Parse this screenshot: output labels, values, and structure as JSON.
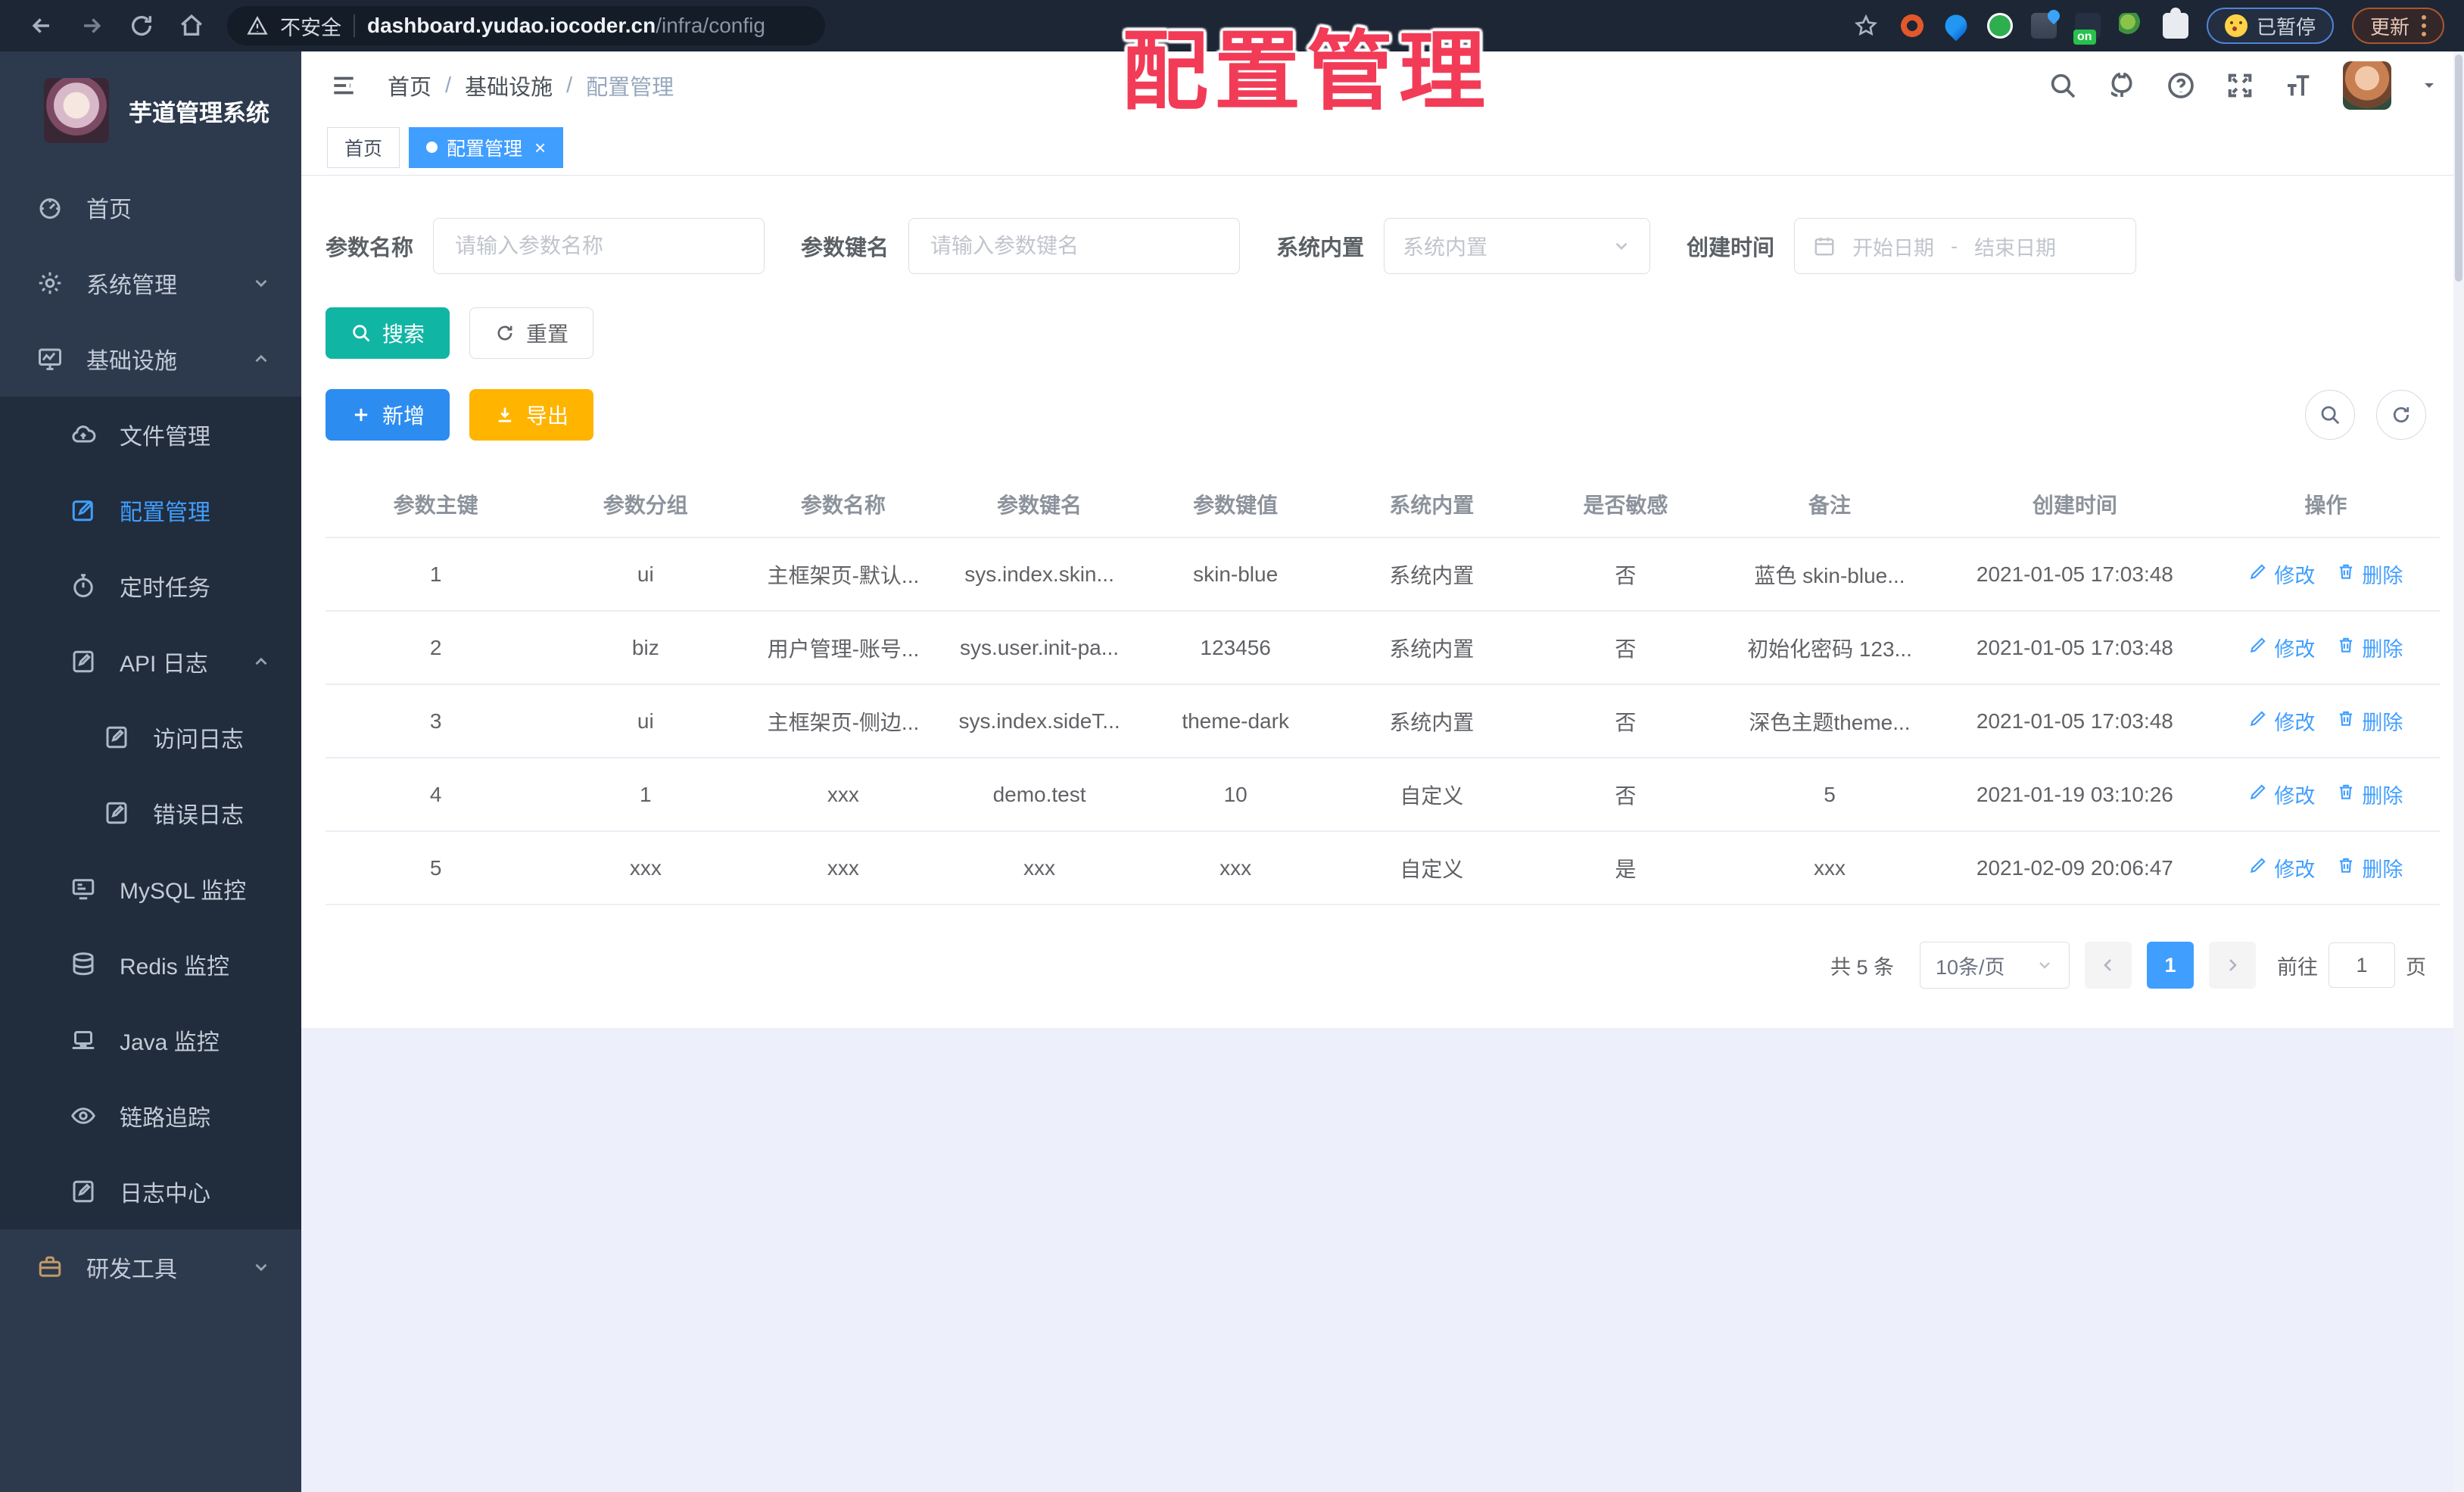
{
  "colors": {
    "accent": "#409eff",
    "search_btn": "#11b5a4",
    "add_btn": "#2d8cf0",
    "export_btn": "#ffb400",
    "overlay_red": "#f23b57",
    "sidebar_bg": "#2d3a4e",
    "submenu_bg": "#212c3c",
    "browser_bg": "#1d2634"
  },
  "overlay_title": "配置管理",
  "browser": {
    "security_label": "不安全",
    "url_host": "dashboard.yudao.iocoder.cn",
    "url_path": "/infra/config",
    "ext_badge": "on",
    "paused_label": "已暂停",
    "update_label": "更新"
  },
  "sidebar": {
    "title": "芋道管理系统",
    "items": [
      {
        "label": "首页",
        "icon": "dashboard-icon",
        "level": 0,
        "sub": false,
        "active": false,
        "chevron": ""
      },
      {
        "label": "系统管理",
        "icon": "gear-icon",
        "level": 0,
        "sub": false,
        "active": false,
        "chevron": "down"
      },
      {
        "label": "基础设施",
        "icon": "monitor-icon",
        "level": 0,
        "sub": false,
        "active": false,
        "chevron": "up"
      },
      {
        "label": "文件管理",
        "icon": "cloud-icon",
        "level": 1,
        "sub": true,
        "active": false,
        "chevron": ""
      },
      {
        "label": "配置管理",
        "icon": "edit-icon",
        "level": 1,
        "sub": true,
        "active": true,
        "chevron": ""
      },
      {
        "label": "定时任务",
        "icon": "timer-icon",
        "level": 1,
        "sub": true,
        "active": false,
        "chevron": ""
      },
      {
        "label": "API 日志",
        "icon": "log-icon",
        "level": 1,
        "sub": true,
        "active": false,
        "chevron": "up"
      },
      {
        "label": "访问日志",
        "icon": "log-icon",
        "level": 2,
        "sub": true,
        "active": false,
        "chevron": ""
      },
      {
        "label": "错误日志",
        "icon": "log-icon",
        "level": 2,
        "sub": true,
        "active": false,
        "chevron": ""
      },
      {
        "label": "MySQL 监控",
        "icon": "mysql-icon",
        "level": 1,
        "sub": true,
        "active": false,
        "chevron": ""
      },
      {
        "label": "Redis 监控",
        "icon": "database-icon",
        "level": 1,
        "sub": true,
        "active": false,
        "chevron": ""
      },
      {
        "label": "Java 监控",
        "icon": "laptop-icon",
        "level": 1,
        "sub": true,
        "active": false,
        "chevron": ""
      },
      {
        "label": "链路追踪",
        "icon": "eye-icon",
        "level": 1,
        "sub": true,
        "active": false,
        "chevron": ""
      },
      {
        "label": "日志中心",
        "icon": "log-icon",
        "level": 1,
        "sub": true,
        "active": false,
        "chevron": ""
      },
      {
        "label": "研发工具",
        "icon": "briefcase-icon",
        "level": 0,
        "sub": false,
        "active": false,
        "chevron": "down",
        "icon_color": "#c09a66"
      }
    ]
  },
  "header": {
    "breadcrumb": [
      "首页",
      "基础设施",
      "配置管理"
    ],
    "breadcrumb_separator": "/"
  },
  "tabs": [
    {
      "label": "首页",
      "active": false,
      "closable": false
    },
    {
      "label": "配置管理",
      "active": true,
      "closable": true
    }
  ],
  "filters": {
    "name_label": "参数名称",
    "name_placeholder": "请输入参数名称",
    "key_label": "参数键名",
    "key_placeholder": "请输入参数键名",
    "type_label": "系统内置",
    "type_placeholder": "系统内置",
    "date_label": "创建时间",
    "date_start": "开始日期",
    "date_separator": "-",
    "date_end": "结束日期"
  },
  "actions": {
    "search": "搜索",
    "reset": "重置",
    "add": "新增",
    "export": "导出"
  },
  "table": {
    "columns": [
      "参数主键",
      "参数分组",
      "参数名称",
      "参数键名",
      "参数键值",
      "系统内置",
      "是否敏感",
      "备注",
      "创建时间",
      "操作"
    ],
    "edit_label": "修改",
    "delete_label": "删除",
    "rows": [
      [
        "1",
        "ui",
        "主框架页-默认...",
        "sys.index.skin...",
        "skin-blue",
        "系统内置",
        "否",
        "蓝色 skin-blue...",
        "2021-01-05 17:03:48"
      ],
      [
        "2",
        "biz",
        "用户管理-账号...",
        "sys.user.init-pa...",
        "123456",
        "系统内置",
        "否",
        "初始化密码 123...",
        "2021-01-05 17:03:48"
      ],
      [
        "3",
        "ui",
        "主框架页-侧边...",
        "sys.index.sideT...",
        "theme-dark",
        "系统内置",
        "否",
        "深色主题theme...",
        "2021-01-05 17:03:48"
      ],
      [
        "4",
        "1",
        "xxx",
        "demo.test",
        "10",
        "自定义",
        "否",
        "5",
        "2021-01-19 03:10:26"
      ],
      [
        "5",
        "xxx",
        "xxx",
        "xxx",
        "xxx",
        "自定义",
        "是",
        "xxx",
        "2021-02-09 20:06:47"
      ]
    ]
  },
  "pagination": {
    "total": "共 5 条",
    "page_size": "10条/页",
    "current_page": "1",
    "goto_label": "前往",
    "goto_value": "1",
    "page_unit": "页"
  }
}
